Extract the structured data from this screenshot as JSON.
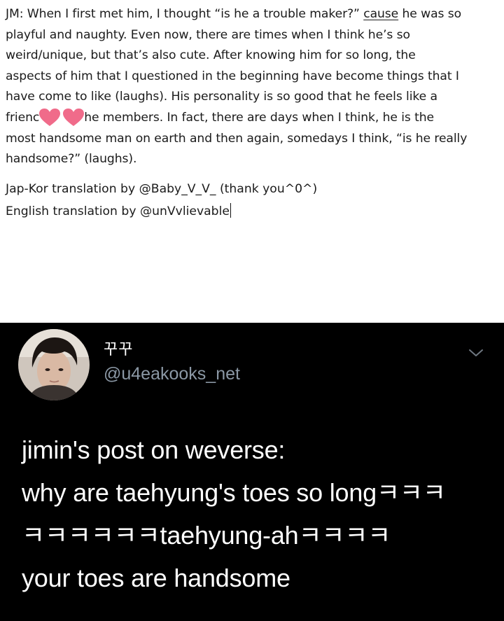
{
  "document": {
    "lines": [
      {
        "pre": "JM: When I first met him, I thought “is he a trouble maker?” ",
        "underlined": "cause",
        "post": " he was so"
      },
      {
        "text": "playful and naughty. Even now, there are times when I think he’s so"
      },
      {
        "text": "weird/unique, but that’s also cute. After knowing him for so long, the"
      },
      {
        "text": "aspects of him that I questioned in the beginning have become things that I"
      },
      {
        "text": "have come to like (laughs). His personality is so good that he feels like a"
      },
      {
        "pre": "frienc",
        "post": "he members. In fact, there are days when I think, he is the"
      },
      {
        "text": "most handsome man on earth and then again, somedays I think, “is he really"
      },
      {
        "text": "handsome?” (laughs)."
      }
    ],
    "credit_1": "Jap-Kor translation by @Baby_V_V_ (thank you^0^)",
    "credit_2": "English translation by @unVvlievable",
    "heart_color": "#f06b8a"
  },
  "tweet": {
    "display_name": "꾸꾸",
    "handle": "@u4eakooks_net",
    "text_lines": [
      "jimin's post on weverse:",
      "why are taehyung's toes so longㅋㅋㅋ",
      "ㅋㅋㅋㅋㅋㅋtaehyung-ahㅋㅋㅋㅋ",
      "your toes are handsome"
    ],
    "background": "#000000",
    "handle_color": "#8b98a5"
  }
}
